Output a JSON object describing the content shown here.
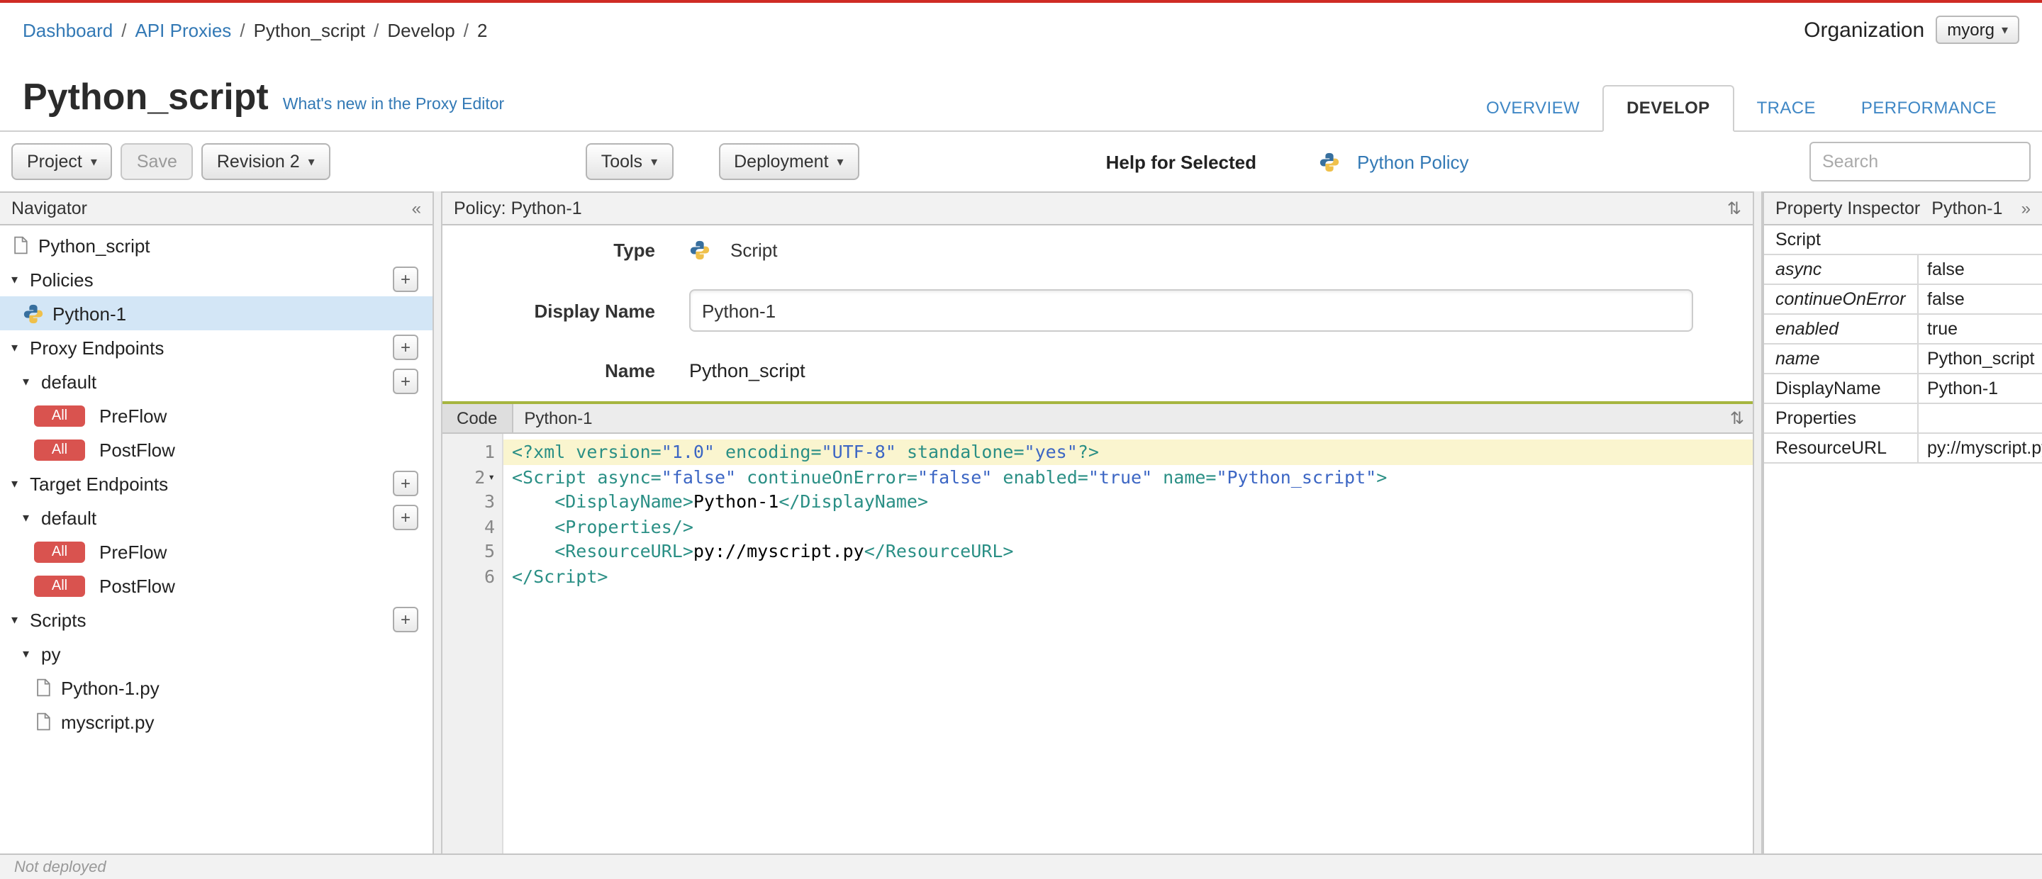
{
  "colors": {
    "top_bar": "#cf2b24",
    "link": "#3379b5",
    "badge_red": "#d9534f",
    "selected_row": "#d3e6f6",
    "code_tag": "#2a8f85",
    "code_string": "#3c66c4",
    "code_highlight": "#faf5cf",
    "splitter_green": "#a6b53f"
  },
  "icons": {
    "dropdown_caret": "▾",
    "tree_expanded": "▾",
    "collapse_left": "«",
    "expand_right": "»",
    "panel_toggle": "⇅"
  },
  "breadcrumb": {
    "separator": "/",
    "items": [
      {
        "label": "Dashboard",
        "link": true
      },
      {
        "label": "API Proxies",
        "link": true
      },
      {
        "label": "Python_script",
        "link": false
      },
      {
        "label": "Develop",
        "link": false
      },
      {
        "label": "2",
        "link": false
      }
    ]
  },
  "organization": {
    "label": "Organization",
    "value": "myorg"
  },
  "header": {
    "title": "Python_script",
    "whats_new_link": "What's new in the Proxy Editor"
  },
  "tabs": [
    {
      "label": "OVERVIEW",
      "active": false
    },
    {
      "label": "DEVELOP",
      "active": true
    },
    {
      "label": "TRACE",
      "active": false
    },
    {
      "label": "PERFORMANCE",
      "active": false
    }
  ],
  "toolbar": {
    "project_label": "Project",
    "save_label": "Save",
    "revision_label": "Revision 2",
    "tools_label": "Tools",
    "deployment_label": "Deployment",
    "help_for_selected_label": "Help for Selected",
    "policy_help_link": "Python Policy",
    "search_placeholder": "Search"
  },
  "navigator": {
    "title": "Navigator",
    "items": [
      {
        "label": "Python_script",
        "level": 0,
        "icon": "file"
      },
      {
        "label": "Policies",
        "level": 0,
        "caret": true,
        "plus": true
      },
      {
        "label": "Python-1",
        "level": 1,
        "icon": "python",
        "selected": true
      },
      {
        "label": "Proxy Endpoints",
        "level": 0,
        "caret": true,
        "plus": true
      },
      {
        "label": "default",
        "level": 1,
        "caret": true,
        "plus": true
      },
      {
        "label": "PreFlow",
        "level": 2,
        "badge": "All"
      },
      {
        "label": "PostFlow",
        "level": 2,
        "badge": "All"
      },
      {
        "label": "Target Endpoints",
        "level": 0,
        "caret": true,
        "plus": true
      },
      {
        "label": "default",
        "level": 1,
        "caret": true,
        "plus": true
      },
      {
        "label": "PreFlow",
        "level": 2,
        "badge": "All"
      },
      {
        "label": "PostFlow",
        "level": 2,
        "badge": "All"
      },
      {
        "label": "Scripts",
        "level": 0,
        "caret": true,
        "plus": true
      },
      {
        "label": "py",
        "level": 1,
        "caret": true
      },
      {
        "label": "Python-1.py",
        "level": 2,
        "icon": "file"
      },
      {
        "label": "myscript.py",
        "level": 2,
        "icon": "file"
      }
    ]
  },
  "policy_panel": {
    "title": "Policy: Python-1",
    "type_label": "Type",
    "type_value": "Script",
    "display_name_label": "Display Name",
    "display_name_value": "Python-1",
    "name_label": "Name",
    "name_value": "Python_script"
  },
  "code_panel": {
    "tab_label": "Code",
    "title": "Python-1",
    "lines": [
      {
        "num": 1,
        "highlight": true,
        "tokens": [
          [
            "tag",
            "<?xml version="
          ],
          [
            "str",
            "\"1.0\""
          ],
          [
            "tag",
            " encoding="
          ],
          [
            "str",
            "\"UTF-8\""
          ],
          [
            "tag",
            " standalone="
          ],
          [
            "str",
            "\"yes\""
          ],
          [
            "tag",
            "?>"
          ]
        ]
      },
      {
        "num": 2,
        "fold": true,
        "tokens": [
          [
            "tag",
            "<Script async="
          ],
          [
            "str",
            "\"false\""
          ],
          [
            "tag",
            " continueOnError="
          ],
          [
            "str",
            "\"false\""
          ],
          [
            "tag",
            " enabled="
          ],
          [
            "str",
            "\"true\""
          ],
          [
            "tag",
            " name="
          ],
          [
            "str",
            "\"Python_script\""
          ],
          [
            "tag",
            ">"
          ]
        ]
      },
      {
        "num": 3,
        "tokens": [
          [
            "tag",
            "    <DisplayName>"
          ],
          [
            "txt",
            "Python-1"
          ],
          [
            "tag",
            "</DisplayName>"
          ]
        ]
      },
      {
        "num": 4,
        "tokens": [
          [
            "tag",
            "    <Properties/>"
          ]
        ]
      },
      {
        "num": 5,
        "tokens": [
          [
            "tag",
            "    <ResourceURL>"
          ],
          [
            "txt",
            "py://myscript.py"
          ],
          [
            "tag",
            "</ResourceURL>"
          ]
        ]
      },
      {
        "num": 6,
        "tokens": [
          [
            "tag",
            "</Script>"
          ]
        ]
      }
    ]
  },
  "inspector": {
    "title": "Property Inspector",
    "subtitle": "Python-1",
    "section_label": "Script",
    "rows": [
      {
        "key": "async",
        "value": "false",
        "is_attr": true
      },
      {
        "key": "continueOnError",
        "value": "false",
        "is_attr": true
      },
      {
        "key": "enabled",
        "value": "true",
        "is_attr": true
      },
      {
        "key": "name",
        "value": "Python_script",
        "is_attr": true
      },
      {
        "key": "DisplayName",
        "value": "Python-1",
        "is_attr": false
      },
      {
        "key": "Properties",
        "value": "",
        "is_attr": false
      },
      {
        "key": "ResourceURL",
        "value": "py://myscript.py",
        "is_attr": false
      }
    ]
  },
  "statusbar": {
    "text": "Not deployed"
  }
}
